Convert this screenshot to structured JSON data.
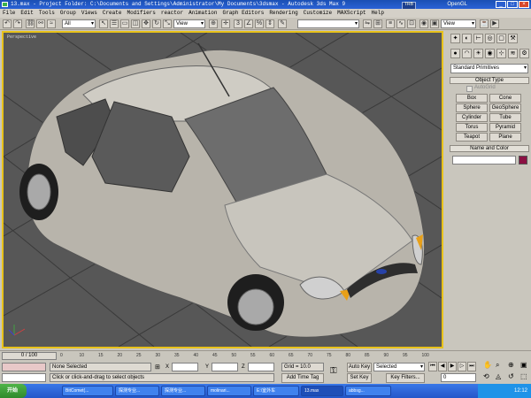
{
  "window": {
    "title": "13.max - Project Folder: C:\\Documents and Settings\\Administrator\\My Documents\\3dsmax - Autodesk 3ds Max 9",
    "badge": "OpenGL",
    "badge_icon_text": "TRB"
  },
  "menu": [
    "File",
    "Edit",
    "Tools",
    "Group",
    "Views",
    "Create",
    "Modifiers",
    "reactor",
    "Animation",
    "Graph Editors",
    "Rendering",
    "Customize",
    "MAXScript",
    "Help"
  ],
  "toolbar": {
    "filter_value": "All",
    "refcoord_value": "View",
    "named_sel_value": "",
    "right_view_value": "View"
  },
  "viewport": {
    "label": "Perspective"
  },
  "command_panel": {
    "category_value": "Standard Primitives",
    "object_type_header": "Object Type",
    "autogrid_label": "AutoGrid",
    "buttons": [
      "Box",
      "Cone",
      "Sphere",
      "GeoSphere",
      "Cylinder",
      "Tube",
      "Torus",
      "Pyramid",
      "Teapot",
      "Plane"
    ],
    "name_color_header": "Name and Color",
    "name_value": "",
    "swatch_color": "#8b1042"
  },
  "timeline": {
    "frame_label": "0 / 100",
    "ticks": [
      "0",
      "10",
      "15",
      "20",
      "25",
      "30",
      "35",
      "40",
      "45",
      "50",
      "55",
      "60",
      "65",
      "70",
      "75",
      "80",
      "85",
      "90",
      "95",
      "100"
    ]
  },
  "status": {
    "selection": "None Selected",
    "prompt": "Click or click-and-drag to select objects",
    "x_label": "X",
    "y_label": "Y",
    "z_label": "Z",
    "grid": "Grid = 10.0",
    "add_time_tag": "Add Time Tag",
    "auto_key": "Auto Key",
    "selected_value": "Selected",
    "set_key": "Set Key",
    "key_filters": "Key Filters...",
    "frame_value": "0"
  },
  "taskbar": {
    "start": "开始",
    "tasks": [
      "BitComet(...",
      "探测专业...",
      "探测专业...",
      "molinari...",
      "E:\\室外车",
      "13.max",
      "abbsg..."
    ],
    "clock": "12:12"
  }
}
